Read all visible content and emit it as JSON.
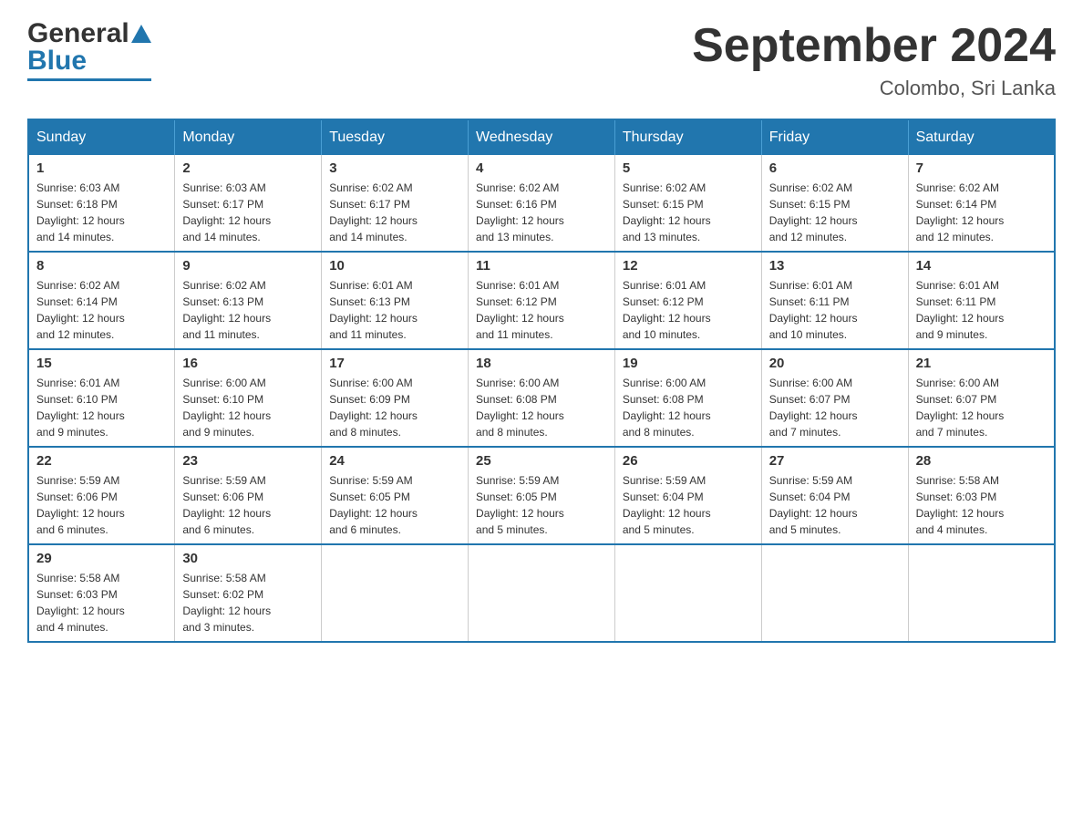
{
  "header": {
    "logo_general": "General",
    "logo_blue": "Blue",
    "month_title": "September 2024",
    "location": "Colombo, Sri Lanka"
  },
  "weekdays": [
    "Sunday",
    "Monday",
    "Tuesday",
    "Wednesday",
    "Thursday",
    "Friday",
    "Saturday"
  ],
  "weeks": [
    [
      {
        "day": "1",
        "sunrise": "6:03 AM",
        "sunset": "6:18 PM",
        "daylight": "12 hours and 14 minutes."
      },
      {
        "day": "2",
        "sunrise": "6:03 AM",
        "sunset": "6:17 PM",
        "daylight": "12 hours and 14 minutes."
      },
      {
        "day": "3",
        "sunrise": "6:02 AM",
        "sunset": "6:17 PM",
        "daylight": "12 hours and 14 minutes."
      },
      {
        "day": "4",
        "sunrise": "6:02 AM",
        "sunset": "6:16 PM",
        "daylight": "12 hours and 13 minutes."
      },
      {
        "day": "5",
        "sunrise": "6:02 AM",
        "sunset": "6:15 PM",
        "daylight": "12 hours and 13 minutes."
      },
      {
        "day": "6",
        "sunrise": "6:02 AM",
        "sunset": "6:15 PM",
        "daylight": "12 hours and 12 minutes."
      },
      {
        "day": "7",
        "sunrise": "6:02 AM",
        "sunset": "6:14 PM",
        "daylight": "12 hours and 12 minutes."
      }
    ],
    [
      {
        "day": "8",
        "sunrise": "6:02 AM",
        "sunset": "6:14 PM",
        "daylight": "12 hours and 12 minutes."
      },
      {
        "day": "9",
        "sunrise": "6:02 AM",
        "sunset": "6:13 PM",
        "daylight": "12 hours and 11 minutes."
      },
      {
        "day": "10",
        "sunrise": "6:01 AM",
        "sunset": "6:13 PM",
        "daylight": "12 hours and 11 minutes."
      },
      {
        "day": "11",
        "sunrise": "6:01 AM",
        "sunset": "6:12 PM",
        "daylight": "12 hours and 11 minutes."
      },
      {
        "day": "12",
        "sunrise": "6:01 AM",
        "sunset": "6:12 PM",
        "daylight": "12 hours and 10 minutes."
      },
      {
        "day": "13",
        "sunrise": "6:01 AM",
        "sunset": "6:11 PM",
        "daylight": "12 hours and 10 minutes."
      },
      {
        "day": "14",
        "sunrise": "6:01 AM",
        "sunset": "6:11 PM",
        "daylight": "12 hours and 9 minutes."
      }
    ],
    [
      {
        "day": "15",
        "sunrise": "6:01 AM",
        "sunset": "6:10 PM",
        "daylight": "12 hours and 9 minutes."
      },
      {
        "day": "16",
        "sunrise": "6:00 AM",
        "sunset": "6:10 PM",
        "daylight": "12 hours and 9 minutes."
      },
      {
        "day": "17",
        "sunrise": "6:00 AM",
        "sunset": "6:09 PM",
        "daylight": "12 hours and 8 minutes."
      },
      {
        "day": "18",
        "sunrise": "6:00 AM",
        "sunset": "6:08 PM",
        "daylight": "12 hours and 8 minutes."
      },
      {
        "day": "19",
        "sunrise": "6:00 AM",
        "sunset": "6:08 PM",
        "daylight": "12 hours and 8 minutes."
      },
      {
        "day": "20",
        "sunrise": "6:00 AM",
        "sunset": "6:07 PM",
        "daylight": "12 hours and 7 minutes."
      },
      {
        "day": "21",
        "sunrise": "6:00 AM",
        "sunset": "6:07 PM",
        "daylight": "12 hours and 7 minutes."
      }
    ],
    [
      {
        "day": "22",
        "sunrise": "5:59 AM",
        "sunset": "6:06 PM",
        "daylight": "12 hours and 6 minutes."
      },
      {
        "day": "23",
        "sunrise": "5:59 AM",
        "sunset": "6:06 PM",
        "daylight": "12 hours and 6 minutes."
      },
      {
        "day": "24",
        "sunrise": "5:59 AM",
        "sunset": "6:05 PM",
        "daylight": "12 hours and 6 minutes."
      },
      {
        "day": "25",
        "sunrise": "5:59 AM",
        "sunset": "6:05 PM",
        "daylight": "12 hours and 5 minutes."
      },
      {
        "day": "26",
        "sunrise": "5:59 AM",
        "sunset": "6:04 PM",
        "daylight": "12 hours and 5 minutes."
      },
      {
        "day": "27",
        "sunrise": "5:59 AM",
        "sunset": "6:04 PM",
        "daylight": "12 hours and 5 minutes."
      },
      {
        "day": "28",
        "sunrise": "5:58 AM",
        "sunset": "6:03 PM",
        "daylight": "12 hours and 4 minutes."
      }
    ],
    [
      {
        "day": "29",
        "sunrise": "5:58 AM",
        "sunset": "6:03 PM",
        "daylight": "12 hours and 4 minutes."
      },
      {
        "day": "30",
        "sunrise": "5:58 AM",
        "sunset": "6:02 PM",
        "daylight": "12 hours and 3 minutes."
      },
      null,
      null,
      null,
      null,
      null
    ]
  ],
  "labels": {
    "sunrise": "Sunrise:",
    "sunset": "Sunset:",
    "daylight": "Daylight:"
  }
}
